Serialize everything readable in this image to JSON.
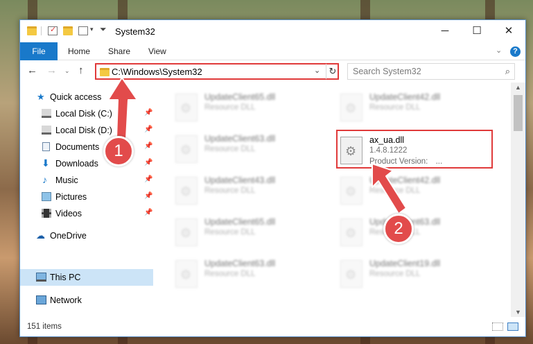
{
  "window": {
    "title": "System32"
  },
  "ribbon": {
    "file": "File",
    "home": "Home",
    "share": "Share",
    "view": "View",
    "help": "?"
  },
  "nav": {
    "address": "C:\\Windows\\System32",
    "search_placeholder": "Search System32"
  },
  "sidebar": {
    "items": [
      {
        "label": "Quick access"
      },
      {
        "label": "Local Disk (C:)"
      },
      {
        "label": "Local Disk (D:)"
      },
      {
        "label": "Documents"
      },
      {
        "label": "Downloads"
      },
      {
        "label": "Music"
      },
      {
        "label": "Pictures"
      },
      {
        "label": "Videos"
      },
      {
        "label": "OneDrive"
      },
      {
        "label": "This PC"
      },
      {
        "label": "Network"
      }
    ]
  },
  "files": [
    {
      "name": "UpdateClient65.dll",
      "type": "Resource DLL"
    },
    {
      "name": "UpdateClient42.dll",
      "type": "Resource DLL"
    },
    {
      "name": "UpdateClient63.dll",
      "type": "Resource DLL"
    },
    {
      "name": "ax_ua.dll",
      "version": "1.4.8.1222",
      "product": "Product Version:",
      "product_value": "..."
    },
    {
      "name": "UpdateClient43.dll",
      "type": "Resource DLL"
    },
    {
      "name": "UpdateClient42.dll",
      "type": "Resource DLL"
    },
    {
      "name": "UpdateClient65.dll",
      "type": "Resource DLL"
    },
    {
      "name": "UpdateClient63.dll",
      "type": "Resource DLL"
    },
    {
      "name": "UpdateClient63.dll",
      "type": "Resource DLL"
    },
    {
      "name": "UpdateClient19.dll",
      "type": "Resource DLL"
    }
  ],
  "status": {
    "items": "151 items"
  },
  "annotations": {
    "step1": "1",
    "step2": "2",
    "color": "#e03a3a"
  }
}
